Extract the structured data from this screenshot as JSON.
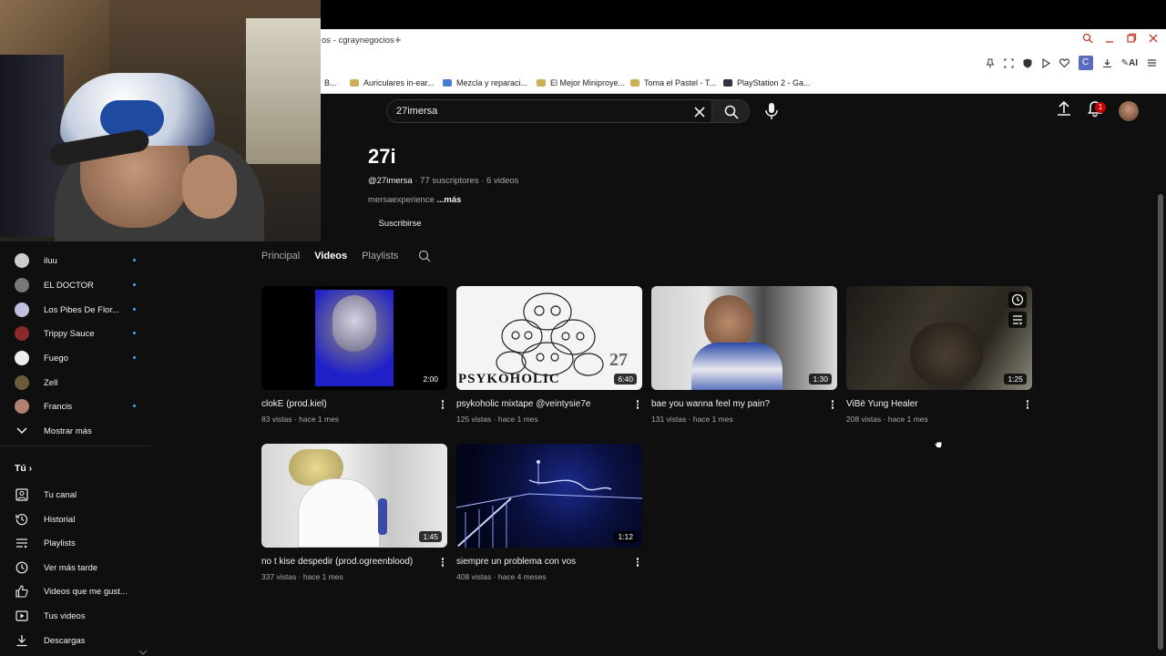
{
  "browser": {
    "tab_title": "os - cgraynegocios",
    "new_tab": "+",
    "bookmarks": [
      {
        "label": "B..."
      },
      {
        "label": "Auriculares in-ear..."
      },
      {
        "label": "Mezcla y reparaci..."
      },
      {
        "label": "El Mejor Miniproye..."
      },
      {
        "label": "Toma el Pastel - T..."
      },
      {
        "label": "PlayStation 2 - Ga..."
      }
    ],
    "toolbar": {
      "ext_label": "C",
      "ai_label": "AI"
    }
  },
  "header": {
    "search": {
      "value": "27imersa"
    },
    "notifications_count": "1"
  },
  "channel": {
    "name": "27i",
    "handle": "@27imersa",
    "subscribers": "77 suscriptores",
    "videos_count": "6 videos",
    "separator": "·",
    "description": "mersaexperience",
    "more": "...más",
    "subscribe_label": "Suscribirse"
  },
  "tabs": [
    {
      "label": "Principal"
    },
    {
      "label": "Videos"
    },
    {
      "label": "Playlists"
    }
  ],
  "sidebar": {
    "subscriptions": [
      {
        "label": "iluu",
        "color": "#cccccc"
      },
      {
        "label": "EL DOCTOR",
        "color": "#777777"
      },
      {
        "label": "Los Pibes De Flor...",
        "color": "#c0c0e0"
      },
      {
        "label": "Trippy Sauce",
        "color": "#8a2a2a"
      },
      {
        "label": "Fuego",
        "color": "#eeeeee"
      },
      {
        "label": "Zell",
        "color": "#6a5a3a"
      },
      {
        "label": "Francis",
        "color": "#b08070"
      }
    ],
    "show_more": "Mostrar más",
    "you_heading": "Tú",
    "you_items": [
      {
        "label": "Tu canal",
        "icon": "account-icon"
      },
      {
        "label": "Historial",
        "icon": "history-icon"
      },
      {
        "label": "Playlists",
        "icon": "playlists-icon"
      },
      {
        "label": "Ver más tarde",
        "icon": "clock-icon"
      },
      {
        "label": "Videos que me gust...",
        "icon": "like-icon"
      },
      {
        "label": "Tus videos",
        "icon": "video-icon"
      },
      {
        "label": "Descargas",
        "icon": "download-icon"
      }
    ]
  },
  "videos": [
    {
      "title": "clokE (prod.kiel)",
      "views": "83 vistas",
      "age": "hace 1 mes",
      "duration": "2:00"
    },
    {
      "title": "psykoholic mixtape @veintysie7e",
      "views": "125 vistas",
      "age": "hace 1 mes",
      "duration": "6:40"
    },
    {
      "title": "bae you wanna feel my pain?",
      "views": "131 vistas",
      "age": "hace 1 mes",
      "duration": "1:30"
    },
    {
      "title": "ViBë Yung Healer",
      "views": "208 vistas",
      "age": "hace 1 mes",
      "duration": "1:25"
    },
    {
      "title": "no t kise despedir (prod.ogreenblood)",
      "views": "337 vistas",
      "age": "hace 1 mes",
      "duration": "1:45"
    },
    {
      "title": "siempre un problema con vos",
      "views": "408 vistas",
      "age": "hace 4 meses",
      "duration": "1:12"
    }
  ],
  "thumb_texts": {
    "psyko_word": "PSYKOHOLIC",
    "psyko_num": "27"
  }
}
